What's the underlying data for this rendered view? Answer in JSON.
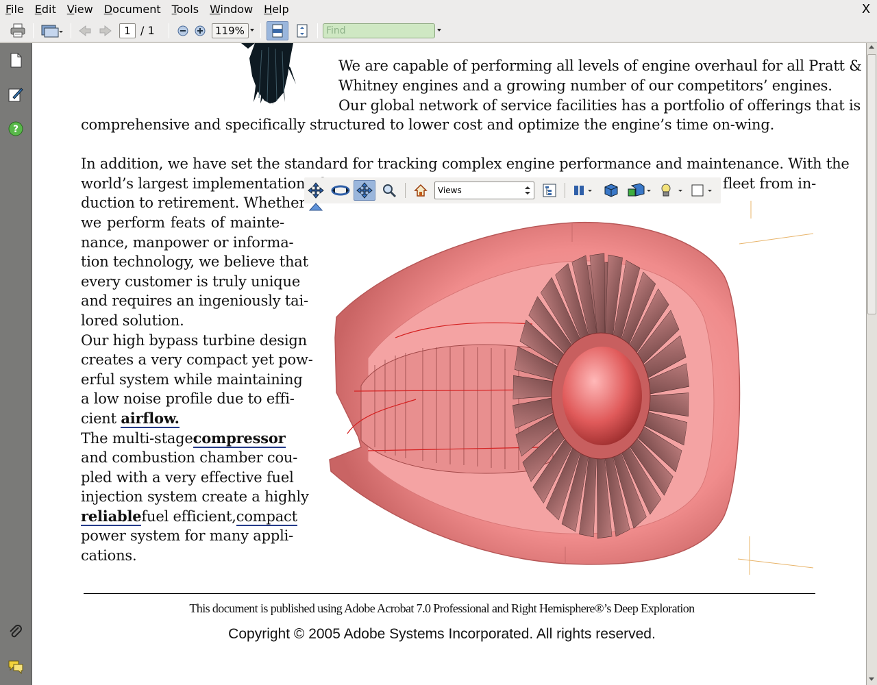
{
  "menu": {
    "items": [
      {
        "label": "File",
        "key": "F",
        "rest": "ile"
      },
      {
        "label": "Edit",
        "key": "E",
        "rest": "dit"
      },
      {
        "label": "View",
        "key": "V",
        "rest": "iew"
      },
      {
        "label": "Document",
        "key": "D",
        "rest": "ocument"
      },
      {
        "label": "Tools",
        "key": "T",
        "rest": "ools"
      },
      {
        "label": "Window",
        "key": "W",
        "rest": "indow"
      },
      {
        "label": "Help",
        "key": "H",
        "rest": "elp"
      }
    ],
    "close_glyph": "X"
  },
  "toolbar": {
    "page_current": "1",
    "page_total": "/ 1",
    "zoom": "119%",
    "find_placeholder": "Find"
  },
  "tb3d": {
    "views_label": "Views"
  },
  "document": {
    "para1": [
      "We are capable of performing all levels of engine overhaul for all Pratt &",
      "Whitney engines and a growing number of our competitors’ engines.",
      "Our global network of service facilities has a portfolio of offerings that is",
      "comprehensive and specifically structured to lower cost and optimize the engine’s time on-wing."
    ],
    "para2_line1": "In addition, we have set the standard for tracking complex engine performance and maintenance. With the",
    "para2_line2_left": "world’s largest implementation of",
    "para2_line2_right": "fleet from in-",
    "col": [
      "duction to retirement. Whether",
      "we perform feats of mainte-",
      "nance, manpower or informa-",
      "tion technology, we believe that",
      "every customer is truly unique",
      "and requires an ingeniously tai-",
      "lored solution.",
      "Our high bypass turbine design",
      "creates a very compact yet pow-",
      "erful system while maintaining",
      "a low noise profile due to effi-"
    ],
    "airflow_prefix": "cient",
    "airflow": "airflow.",
    "compressor_prefix": "The multi-stage",
    "compressor": "compressor",
    "col2": [
      "and combustion chamber cou-",
      "pled with a very effective fuel",
      "injection system create a highly"
    ],
    "reliable": "reliable",
    "reliable_mid": "fuel efficient,",
    "compact": "compact",
    "col3": [
      "power system for many appli-",
      "cations."
    ],
    "footer1": "This document is published using Adobe Acrobat 7.0 Professional and Right Hemisphere®’s Deep Exploration",
    "footer2": "Copyright © 2005 Adobe Systems Incorporated. All rights reserved."
  },
  "colors": {
    "engine": "#f08c8c",
    "link_underline": "#233a8a"
  }
}
